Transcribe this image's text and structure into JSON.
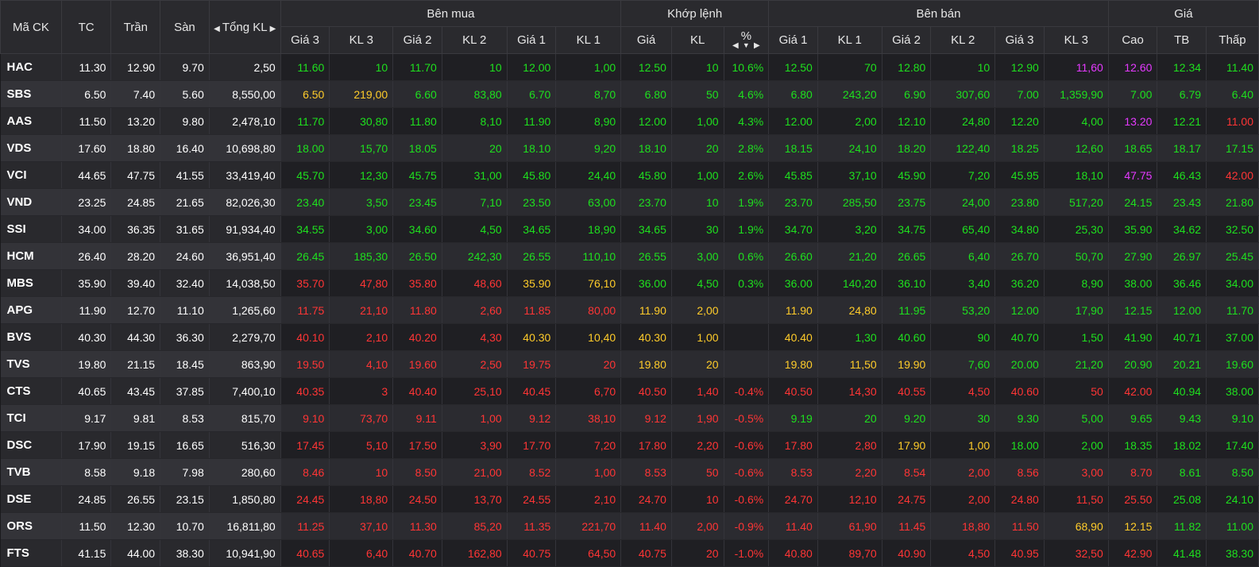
{
  "header": {
    "symbol": "Mã CK",
    "ref": "TC",
    "ceiling": "Trần",
    "floor": "Sàn",
    "total_volume": "Tổng KL",
    "buy_group": "Bên mua",
    "match_group": "Khớp lệnh",
    "sell_group": "Bên bán",
    "price_group": "Giá",
    "buy_cols": [
      "Giá 3",
      "KL 3",
      "Giá 2",
      "KL 2",
      "Giá 1",
      "KL 1"
    ],
    "match_cols": [
      "Giá",
      "KL",
      "%"
    ],
    "sell_cols": [
      "Giá 1",
      "KL 1",
      "Giá 2",
      "KL 2",
      "Giá 3",
      "KL 3"
    ],
    "price_cols": [
      "Cao",
      "TB",
      "Thấp"
    ]
  },
  "colors": {
    "up": "#1ee01e",
    "down": "#ff3535",
    "ref": "#ffcc2a",
    "ceiling": "#e53aff",
    "floor": "#35d9f5",
    "header_bg": "#2a2a2e"
  },
  "rows": [
    {
      "c": [
        "HAC",
        "11.30",
        "12.90",
        "9.70",
        "2,50",
        "11.60",
        "10",
        "11.70",
        "10",
        "12.00",
        "1,00",
        "12.50",
        "10",
        "10.6%",
        "12.50",
        "70",
        "12.80",
        "10",
        "12.90",
        "11,60",
        "12.60",
        "12.34",
        "11.40"
      ],
      "k": "gycbwggggggggggggggccggg"
    },
    {
      "c": [
        "SBS",
        "6.50",
        "7.40",
        "5.60",
        "8,550,00",
        "6.50",
        "219,00",
        "6.60",
        "83,80",
        "6.70",
        "8,70",
        "6.80",
        "50",
        "4.6%",
        "6.80",
        "243,20",
        "6.90",
        "307,60",
        "7.00",
        "1,359,90",
        "7.00",
        "6.79",
        "6.40"
      ],
      "k": "gycbwyyggggggggggggggggr"
    },
    {
      "c": [
        "AAS",
        "11.50",
        "13.20",
        "9.80",
        "2,478,10",
        "11.70",
        "30,80",
        "11.80",
        "8,10",
        "11.90",
        "8,90",
        "12.00",
        "1,00",
        "4.3%",
        "12.00",
        "2,00",
        "12.10",
        "24,80",
        "12.20",
        "4,00",
        "13.20",
        "12.21",
        "11.00"
      ],
      "k": "gycbwgggggggggggggggcgr"
    },
    {
      "c": [
        "VDS",
        "17.60",
        "18.80",
        "16.40",
        "10,698,80",
        "18.00",
        "15,70",
        "18.05",
        "20",
        "18.10",
        "9,20",
        "18.10",
        "20",
        "2.8%",
        "18.15",
        "24,10",
        "18.20",
        "122,40",
        "18.25",
        "12,60",
        "18.65",
        "18.17",
        "17.15"
      ],
      "k": "gycbwggggggggggggggggggr"
    },
    {
      "c": [
        "VCI",
        "44.65",
        "47.75",
        "41.55",
        "33,419,40",
        "45.70",
        "12,30",
        "45.75",
        "31,00",
        "45.80",
        "24,40",
        "45.80",
        "1,00",
        "2.6%",
        "45.85",
        "37,10",
        "45.90",
        "7,20",
        "45.95",
        "18,10",
        "47.75",
        "46.43",
        "42.00"
      ],
      "k": "gycbwgggggggggggggggcgr"
    },
    {
      "c": [
        "VND",
        "23.25",
        "24.85",
        "21.65",
        "82,026,30",
        "23.40",
        "3,50",
        "23.45",
        "7,10",
        "23.50",
        "63,00",
        "23.70",
        "10",
        "1.9%",
        "23.70",
        "285,50",
        "23.75",
        "24,00",
        "23.80",
        "517,20",
        "24.15",
        "23.43",
        "21.80"
      ],
      "k": "gycbwggggggggggggggggggr"
    },
    {
      "c": [
        "SSI",
        "34.00",
        "36.35",
        "31.65",
        "91,934,40",
        "34.55",
        "3,00",
        "34.60",
        "4,50",
        "34.65",
        "18,90",
        "34.65",
        "30",
        "1.9%",
        "34.70",
        "3,20",
        "34.75",
        "65,40",
        "34.80",
        "25,30",
        "35.90",
        "34.62",
        "32.50"
      ],
      "k": "gycbwggggggggggggggggggr"
    },
    {
      "c": [
        "HCM",
        "26.40",
        "28.20",
        "24.60",
        "36,951,40",
        "26.45",
        "185,30",
        "26.50",
        "242,30",
        "26.55",
        "110,10",
        "26.55",
        "3,00",
        "0.6%",
        "26.60",
        "21,20",
        "26.65",
        "6,40",
        "26.70",
        "50,70",
        "27.90",
        "26.97",
        "25.45"
      ],
      "k": "gycbwggggggggggggggggggr"
    },
    {
      "c": [
        "MBS",
        "35.90",
        "39.40",
        "32.40",
        "14,038,50",
        "35.70",
        "47,80",
        "35.80",
        "48,60",
        "35.90",
        "76,10",
        "36.00",
        "4,50",
        "0.3%",
        "36.00",
        "140,20",
        "36.10",
        "3,40",
        "36.20",
        "8,90",
        "38.00",
        "36.46",
        "34.00"
      ],
      "k": "gycbwrrrryyggggggggggggr"
    },
    {
      "c": [
        "APG",
        "11.90",
        "12.70",
        "11.10",
        "1,265,60",
        "11.75",
        "21,10",
        "11.80",
        "2,60",
        "11.85",
        "80,00",
        "11.90",
        "2,00",
        "",
        "11.90",
        "24,80",
        "11.95",
        "53,20",
        "12.00",
        "17,90",
        "12.15",
        "12.00",
        "11.70"
      ],
      "k": "yycbwrrrrrryyyyyggggggggr"
    },
    {
      "c": [
        "BVS",
        "40.30",
        "44.30",
        "36.30",
        "2,279,70",
        "40.10",
        "2,10",
        "40.20",
        "4,30",
        "40.30",
        "10,40",
        "40.30",
        "1,00",
        "",
        "40.40",
        "1,30",
        "40.60",
        "90",
        "40.70",
        "1,50",
        "41.90",
        "40.71",
        "37.00"
      ],
      "k": "yycbwrrrryyyyyyggggggggr"
    },
    {
      "c": [
        "TVS",
        "19.80",
        "21.15",
        "18.45",
        "863,90",
        "19.50",
        "4,10",
        "19.60",
        "2,50",
        "19.75",
        "20",
        "19.80",
        "20",
        "",
        "19.80",
        "11,50",
        "19.90",
        "7,60",
        "20.00",
        "21,20",
        "20.90",
        "20.21",
        "19.60"
      ],
      "k": "yycbwrrrrrryyyyyyggggggggr"
    },
    {
      "c": [
        "CTS",
        "40.65",
        "43.45",
        "37.85",
        "7,400,10",
        "40.35",
        "3",
        "40.40",
        "25,10",
        "40.45",
        "6,70",
        "40.50",
        "1,40",
        "-0.4%",
        "40.50",
        "14,30",
        "40.55",
        "4,50",
        "40.60",
        "50",
        "42.00",
        "40.94",
        "38.00"
      ],
      "k": "rycbwrrrrrrrrrrrrrrrrggr"
    },
    {
      "c": [
        "TCI",
        "9.17",
        "9.81",
        "8.53",
        "815,70",
        "9.10",
        "73,70",
        "9.11",
        "1,00",
        "9.12",
        "38,10",
        "9.12",
        "1,90",
        "-0.5%",
        "9.19",
        "20",
        "9.20",
        "30",
        "9.30",
        "5,00",
        "9.65",
        "9.43",
        "9.10"
      ],
      "k": "rycbwrrrrrrrrrggggggggggr"
    },
    {
      "c": [
        "DSC",
        "17.90",
        "19.15",
        "16.65",
        "516,30",
        "17.45",
        "5,10",
        "17.50",
        "3,90",
        "17.70",
        "7,20",
        "17.80",
        "2,20",
        "-0.6%",
        "17.80",
        "2,80",
        "17.90",
        "1,00",
        "18.00",
        "2,00",
        "18.35",
        "18.02",
        "17.40"
      ],
      "k": "rycbwrrrrrrrrrrryyggggggr"
    },
    {
      "c": [
        "TVB",
        "8.58",
        "9.18",
        "7.98",
        "280,60",
        "8.46",
        "10",
        "8.50",
        "21,00",
        "8.52",
        "1,00",
        "8.53",
        "50",
        "-0.6%",
        "8.53",
        "2,20",
        "8.54",
        "2,00",
        "8.56",
        "3,00",
        "8.70",
        "8.61",
        "8.50"
      ],
      "k": "rycbwrrrrrrrrrrrrrrrrggr"
    },
    {
      "c": [
        "DSE",
        "24.85",
        "26.55",
        "23.15",
        "1,850,80",
        "24.45",
        "18,80",
        "24.50",
        "13,70",
        "24.55",
        "2,10",
        "24.70",
        "10",
        "-0.6%",
        "24.70",
        "12,10",
        "24.75",
        "2,00",
        "24.80",
        "11,50",
        "25.50",
        "25.08",
        "24.10"
      ],
      "k": "rycbwrrrrrrrrrrrrrrrrggr"
    },
    {
      "c": [
        "ORS",
        "11.50",
        "12.30",
        "10.70",
        "16,811,80",
        "11.25",
        "37,10",
        "11.30",
        "85,20",
        "11.35",
        "221,70",
        "11.40",
        "2,00",
        "-0.9%",
        "11.40",
        "61,90",
        "11.45",
        "18,80",
        "11.50",
        "68,90",
        "12.15",
        "11.82",
        "11.00"
      ],
      "k": "rycbwrrrrrrrrrrrrrryyggr"
    },
    {
      "c": [
        "FTS",
        "41.15",
        "44.00",
        "38.30",
        "10,941,90",
        "40.65",
        "6,40",
        "40.70",
        "162,80",
        "40.75",
        "64,50",
        "40.75",
        "20",
        "-1.0%",
        "40.80",
        "89,70",
        "40.90",
        "4,50",
        "40.95",
        "32,50",
        "42.90",
        "41.48",
        "38.30"
      ],
      "k": "rycbwrrrrrrrrrrrrrrrrggb"
    }
  ]
}
